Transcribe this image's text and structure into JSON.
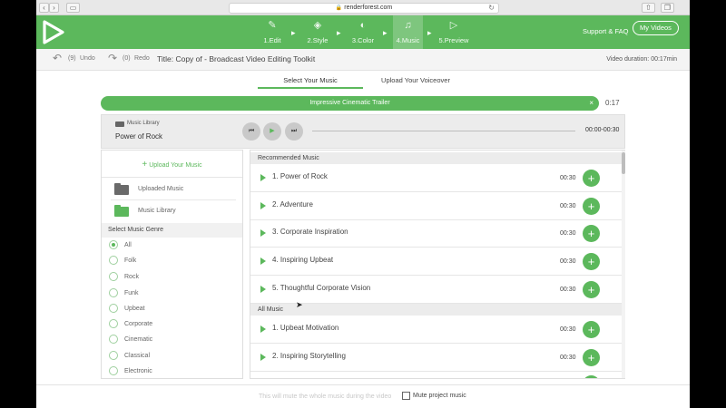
{
  "browser": {
    "url": "renderforest.com"
  },
  "header": {
    "steps": [
      {
        "label": "1.Edit",
        "icon": "pencil-icon"
      },
      {
        "label": "2.Style",
        "icon": "layers-icon"
      },
      {
        "label": "3.Color",
        "icon": "paint-bucket-icon"
      },
      {
        "label": "4.Music",
        "icon": "music-note-icon",
        "active": true
      },
      {
        "label": "5.Preview",
        "icon": "play-icon"
      }
    ],
    "support_label": "Support & FAQ",
    "my_videos_label": "My Videos",
    "accent_color": "#5cb85c"
  },
  "toolbar": {
    "undo_count": "(9)",
    "undo_label": "Undo",
    "redo_count": "(0)",
    "redo_label": "Redo",
    "title": "Title: Copy of - Broadcast Video Editing Toolkit",
    "duration": "Video duration: 00:17min"
  },
  "tabs": {
    "music": "Select Your Music",
    "voiceover": "Upload Your Voiceover"
  },
  "banner": {
    "track": "Impressive Cinematic Trailer",
    "time": "0:17"
  },
  "player": {
    "library_label": "Music Library",
    "track": "Power of Rock",
    "time_range": "00:00-00:30"
  },
  "sidebar": {
    "upload_label": "Upload Your Music",
    "uploaded_label": "Uploaded Music",
    "library_label": "Music Library",
    "genre_header": "Select Music Genre",
    "genres": [
      {
        "label": "All",
        "selected": true
      },
      {
        "label": "Folk"
      },
      {
        "label": "Rock"
      },
      {
        "label": "Funk"
      },
      {
        "label": "Upbeat"
      },
      {
        "label": "Corporate"
      },
      {
        "label": "Cinematic"
      },
      {
        "label": "Classical"
      },
      {
        "label": "Electronic"
      }
    ]
  },
  "music_list": {
    "recommended_header": "Recommended Music",
    "recommended": [
      {
        "name": "1. Power of Rock",
        "duration": "00:30"
      },
      {
        "name": "2. Adventure",
        "duration": "00:30"
      },
      {
        "name": "3. Corporate Inspiration",
        "duration": "00:30"
      },
      {
        "name": "4. Inspiring Upbeat",
        "duration": "00:30"
      },
      {
        "name": "5. Thoughtful Corporate Vision",
        "duration": "00:30"
      }
    ],
    "all_header": "All Music",
    "all": [
      {
        "name": "1. Upbeat Motivation",
        "duration": "00:30"
      },
      {
        "name": "2. Inspiring Storytelling",
        "duration": "00:30"
      }
    ]
  },
  "footer": {
    "note": "This will mute the whole music during the video",
    "mute_label": "Mute project music"
  }
}
